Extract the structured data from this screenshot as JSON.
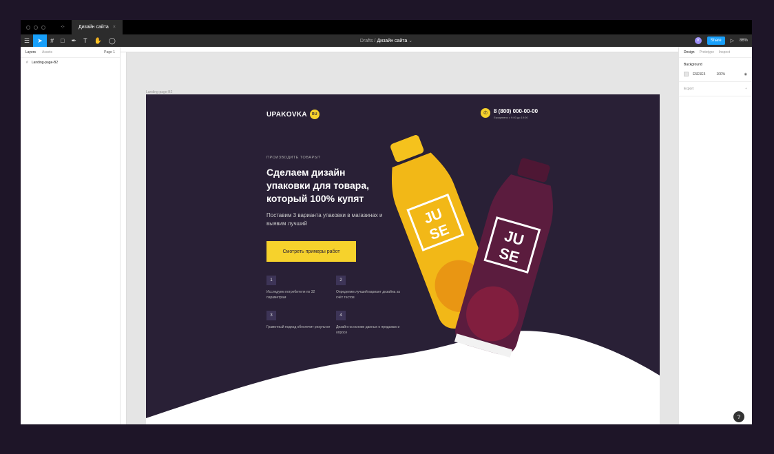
{
  "app": {
    "file_tab": "Дизайн сайта",
    "breadcrumb_parent": "Drafts",
    "breadcrumb_sep": "/",
    "breadcrumb_current": "Дизайн сайта",
    "share_label": "Share",
    "zoom_label": "86%",
    "avatar_initial": "V"
  },
  "left_panel": {
    "tab_layers": "Layers",
    "tab_assets": "Assets",
    "page_label": "Page 1",
    "layers": [
      {
        "label": "Landing-page-B2"
      }
    ]
  },
  "right_panel": {
    "tab_design": "Design",
    "tab_prototype": "Prototype",
    "tab_inspect": "Inspect",
    "background_title": "Background",
    "bg_color": "E5E5E5",
    "bg_opacity": "100%",
    "export_label": "Export"
  },
  "canvas": {
    "frame_label": "Landing-page-B2"
  },
  "landing": {
    "logo_text": "UPAKOVKA",
    "logo_badge": "RU",
    "phone": "8 (800) 000-00-00",
    "hours": "Ежедневно с 9:00 до 19:00",
    "eyebrow": "ПРОИЗВОДИТЕ ТОВАРЫ?",
    "headline": "Сделаем дизайн упаковки для товара, который 100% купят",
    "subtitle": "Поставим 3 варианта упаковки в магазинах и выявим лучший",
    "cta": "Смотреть примеры работ",
    "features": [
      {
        "num": "1",
        "text": "Исследуем потребителя по 32 параметрам"
      },
      {
        "num": "2",
        "text": "Определим лучший вариант дизайна за счёт тестов"
      },
      {
        "num": "3",
        "text": "Грамотный подход обеспечит результат"
      },
      {
        "num": "4",
        "text": "Дизайн на основе данных о продажах и опросе"
      }
    ],
    "bottle_brand_top": "JU",
    "bottle_brand_bottom": "SE",
    "colors": {
      "frame_bg": "#292036",
      "accent": "#f6d22c",
      "yellow_bottle": "#f2b817",
      "purple_bottle": "#5b1c3e"
    }
  }
}
